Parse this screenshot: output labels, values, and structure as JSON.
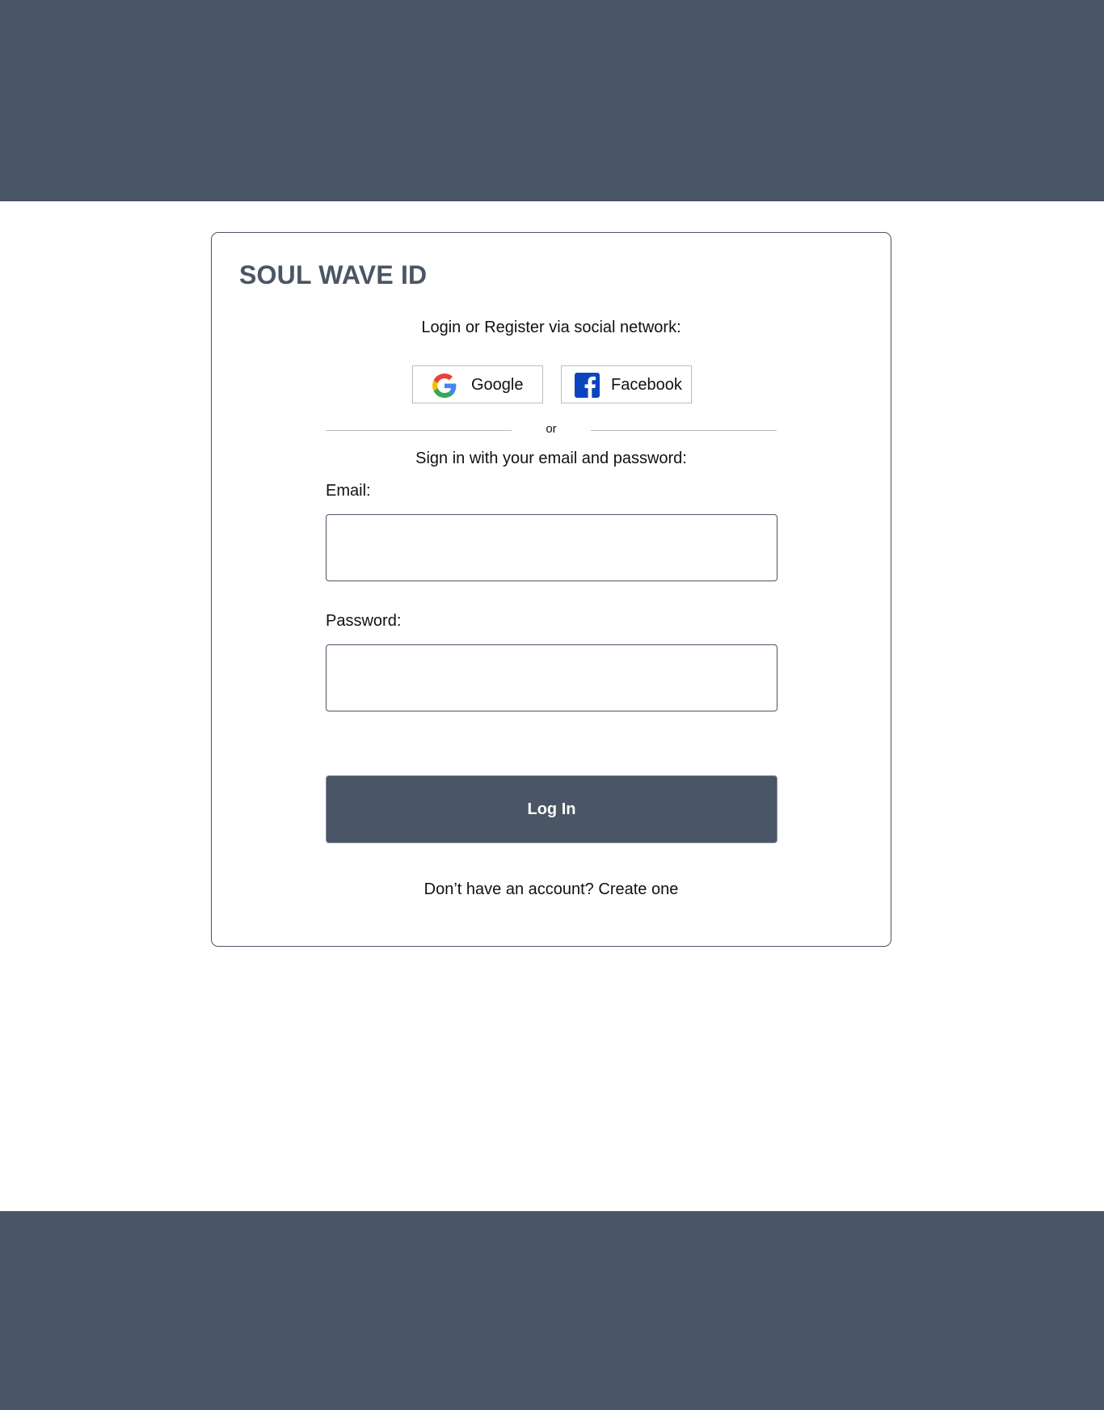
{
  "colors": {
    "primary": "#4a5565",
    "background": "#ffffff",
    "text": "#111111",
    "border_light": "#b9bcc2",
    "facebook_blue": "#0b45be"
  },
  "brand": {
    "title": "SOUL WAVE ID"
  },
  "social": {
    "prompt": "Login or Register via social network:",
    "providers": [
      {
        "label": "Google",
        "icon": "google-icon"
      },
      {
        "label": "Facebook",
        "icon": "facebook-icon"
      }
    ]
  },
  "divider": {
    "text": "or"
  },
  "form": {
    "prompt": "Sign in with your email and password:",
    "email": {
      "label": "Email:",
      "value": "",
      "placeholder": ""
    },
    "password": {
      "label": "Password:",
      "value": "",
      "placeholder": ""
    },
    "submit_label": "Log In"
  },
  "register": {
    "prefix": "Don’t have an account?",
    "link_label": "Create one"
  }
}
